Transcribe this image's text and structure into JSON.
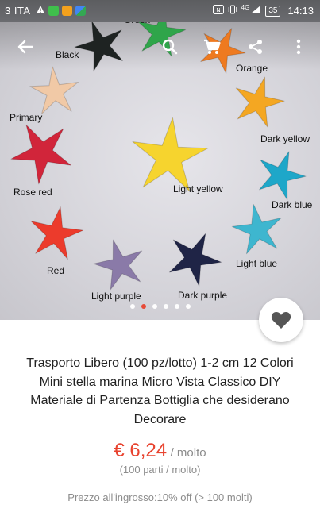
{
  "status_bar": {
    "carrier": "3 ITA",
    "time": "14:13",
    "battery": "35",
    "network": "4G",
    "icons": [
      "warning-icon",
      "whatsapp-icon",
      "message-icon",
      "maps-icon",
      "nfc-icon",
      "vibrate-icon",
      "signal-icon"
    ]
  },
  "toolbar": {
    "back_icon": "arrow-left-icon",
    "search_icon": "search-icon",
    "cart_icon": "cart-icon",
    "share_icon": "share-icon",
    "more_icon": "more-vertical-icon"
  },
  "gallery": {
    "stars": [
      {
        "label": "Green",
        "color": "#2fa54a"
      },
      {
        "label": "Black",
        "color": "#1e2322"
      },
      {
        "label": "Orange",
        "color": "#ee7a20"
      },
      {
        "label": "Primary",
        "color": "#f1c9a6"
      },
      {
        "label": "Dark yellow",
        "color": "#f4a722"
      },
      {
        "label": "Rose red",
        "color": "#d1253a"
      },
      {
        "label": "Light yellow",
        "color": "#f6d42e"
      },
      {
        "label": "Dark blue",
        "color": "#1ea7c9"
      },
      {
        "label": "Light blue",
        "color": "#3eb6cf"
      },
      {
        "label": "Red",
        "color": "#ec3b2c"
      },
      {
        "label": "Light purple",
        "color": "#8a7aa8"
      },
      {
        "label": "Dark purple",
        "color": "#1f2446"
      }
    ],
    "page_count": 6,
    "active_page": 2
  },
  "product": {
    "title": "Trasporto Libero (100 pz/lotto) 1-2 cm 12 Colori Mini stella marina Micro Vista Classico DIY Materiale di Partenza Bottiglia che desiderano Decorare",
    "price": "€ 6,24",
    "price_unit": "/ molto",
    "lot_info": "(100 parti / molto)",
    "wholesale": "Prezzo all'ingrosso:10% off (> 100 molti)",
    "accent_color": "#e8432f",
    "favorite_icon": "heart-icon"
  }
}
